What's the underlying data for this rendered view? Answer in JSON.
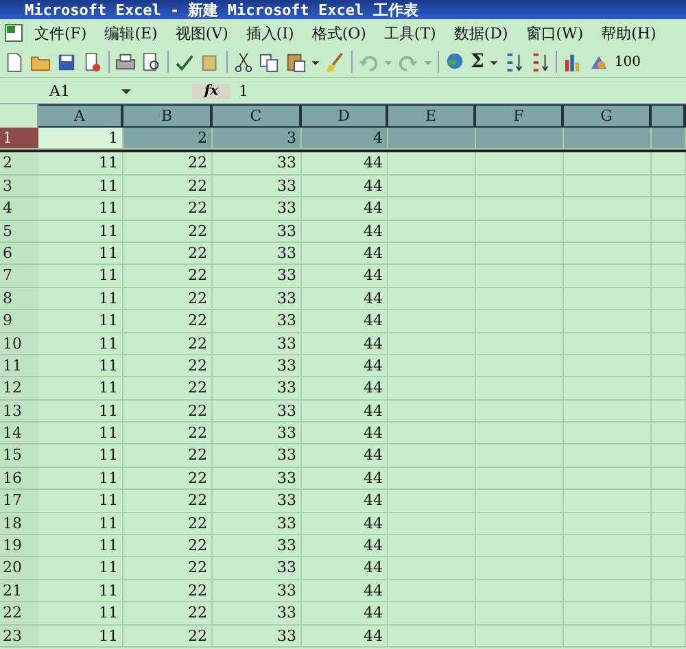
{
  "window": {
    "title": "Microsoft Excel - 新建 Microsoft Excel 工作表"
  },
  "menu": [
    "文件(F)",
    "编辑(E)",
    "视图(V)",
    "插入(I)",
    "格式(O)",
    "工具(T)",
    "数据(D)",
    "窗口(W)",
    "帮助(H)"
  ],
  "toolbar": {
    "sum_symbol": "Σ",
    "zoom": "100"
  },
  "formula_bar": {
    "name_box": "A1",
    "fx": "fx",
    "value": "1"
  },
  "columns": [
    "A",
    "B",
    "C",
    "D",
    "E",
    "F",
    "G"
  ],
  "rows": [
    {
      "number": "1",
      "selected": true,
      "cells": [
        "1",
        "2",
        "3",
        "4"
      ]
    },
    {
      "number": "2",
      "selected": false,
      "cells": [
        "11",
        "22",
        "33",
        "44"
      ]
    },
    {
      "number": "3",
      "selected": false,
      "cells": [
        "11",
        "22",
        "33",
        "44"
      ]
    },
    {
      "number": "4",
      "selected": false,
      "cells": [
        "11",
        "22",
        "33",
        "44"
      ]
    },
    {
      "number": "5",
      "selected": false,
      "cells": [
        "11",
        "22",
        "33",
        "44"
      ]
    },
    {
      "number": "6",
      "selected": false,
      "cells": [
        "11",
        "22",
        "33",
        "44"
      ]
    },
    {
      "number": "7",
      "selected": false,
      "cells": [
        "11",
        "22",
        "33",
        "44"
      ]
    },
    {
      "number": "8",
      "selected": false,
      "cells": [
        "11",
        "22",
        "33",
        "44"
      ]
    },
    {
      "number": "9",
      "selected": false,
      "cells": [
        "11",
        "22",
        "33",
        "44"
      ]
    },
    {
      "number": "10",
      "selected": false,
      "cells": [
        "11",
        "22",
        "33",
        "44"
      ]
    },
    {
      "number": "11",
      "selected": false,
      "cells": [
        "11",
        "22",
        "33",
        "44"
      ]
    },
    {
      "number": "12",
      "selected": false,
      "cells": [
        "11",
        "22",
        "33",
        "44"
      ]
    },
    {
      "number": "13",
      "selected": false,
      "cells": [
        "11",
        "22",
        "33",
        "44"
      ]
    },
    {
      "number": "14",
      "selected": false,
      "cells": [
        "11",
        "22",
        "33",
        "44"
      ]
    },
    {
      "number": "15",
      "selected": false,
      "cells": [
        "11",
        "22",
        "33",
        "44"
      ]
    },
    {
      "number": "16",
      "selected": false,
      "cells": [
        "11",
        "22",
        "33",
        "44"
      ]
    },
    {
      "number": "17",
      "selected": false,
      "cells": [
        "11",
        "22",
        "33",
        "44"
      ]
    },
    {
      "number": "18",
      "selected": false,
      "cells": [
        "11",
        "22",
        "33",
        "44"
      ]
    },
    {
      "number": "19",
      "selected": false,
      "cells": [
        "11",
        "22",
        "33",
        "44"
      ]
    },
    {
      "number": "20",
      "selected": false,
      "cells": [
        "11",
        "22",
        "33",
        "44"
      ]
    },
    {
      "number": "21",
      "selected": false,
      "cells": [
        "11",
        "22",
        "33",
        "44"
      ]
    },
    {
      "number": "22",
      "selected": false,
      "cells": [
        "11",
        "22",
        "33",
        "44"
      ]
    },
    {
      "number": "23",
      "selected": false,
      "cells": [
        "11",
        "22",
        "33",
        "44"
      ]
    }
  ]
}
